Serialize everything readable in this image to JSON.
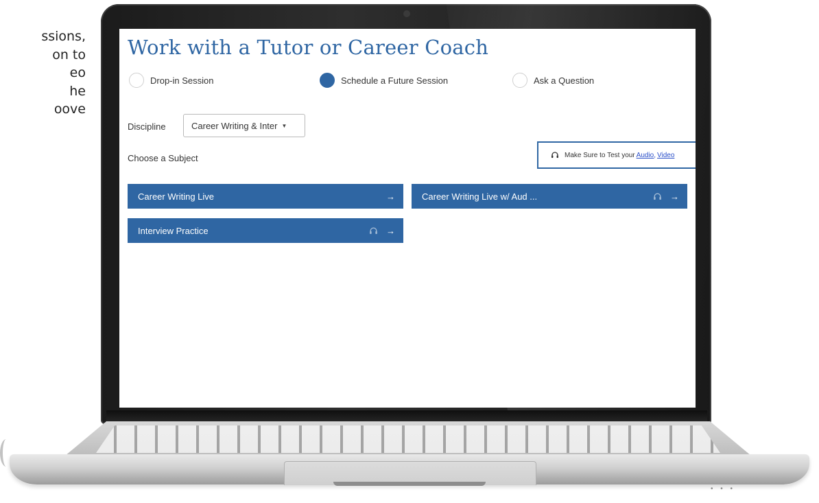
{
  "side_text": {
    "lines": [
      "ssions,",
      "on to",
      "eo",
      "he",
      "oove"
    ]
  },
  "header": {
    "title": "Work with a Tutor or Career Coach"
  },
  "session_type": {
    "options": [
      {
        "label": "Drop-in Session",
        "selected": false
      },
      {
        "label": "Schedule a Future Session",
        "selected": true
      },
      {
        "label": "Ask a Question",
        "selected": false
      }
    ]
  },
  "discipline": {
    "label": "Discipline",
    "selected_value": "Career Writing & Inter"
  },
  "subject": {
    "label": "Choose a Subject",
    "options": [
      {
        "label": "Career Writing Live",
        "audio": false
      },
      {
        "label": "Career Writing Live w/ Aud ...",
        "audio": true
      },
      {
        "label": "Interview Practice",
        "audio": true
      }
    ]
  },
  "test_notice": {
    "text": "Make Sure to Test your",
    "audio_link": "Audio,",
    "video_link": "Video"
  },
  "colors": {
    "accent": "#2f66a3",
    "link": "#2a4fc9"
  },
  "icons": {
    "headset": "headset-icon",
    "arrow": "arrow-right-icon",
    "caret": "caret-down-icon"
  }
}
